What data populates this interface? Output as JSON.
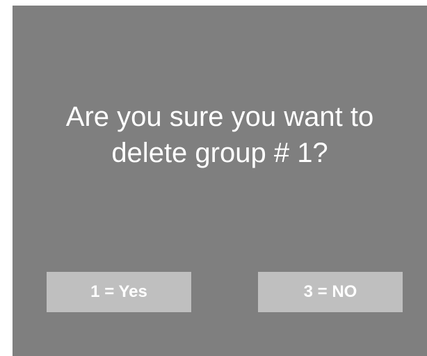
{
  "dialog": {
    "message_line1": "Are you sure you want to",
    "message_line2": "delete group # 1?",
    "yes_label": "1 = Yes",
    "no_label": "3 = NO"
  },
  "colors": {
    "dialog_background": "#7f7f7f",
    "button_background": "#bfbfbf",
    "text": "#ffffff",
    "page_background": "#ffffff"
  }
}
